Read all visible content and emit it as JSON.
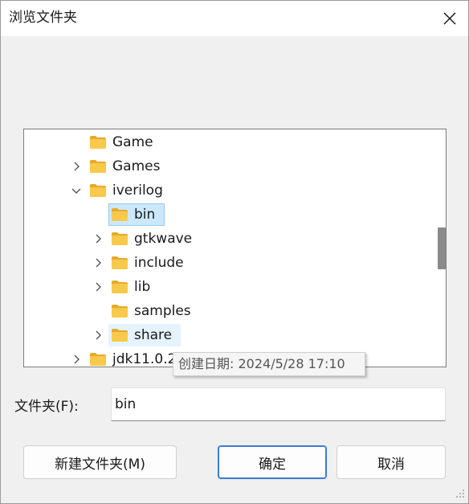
{
  "window": {
    "title": "浏览文件夹"
  },
  "tree": {
    "items": [
      {
        "label": "Game",
        "expander": "none"
      },
      {
        "label": "Games",
        "expander": "collapsed"
      },
      {
        "label": "iverilog",
        "expander": "expanded"
      },
      {
        "label": "bin",
        "expander": "none",
        "state": "selected"
      },
      {
        "label": "gtkwave",
        "expander": "collapsed"
      },
      {
        "label": "include",
        "expander": "collapsed"
      },
      {
        "label": "lib",
        "expander": "collapsed"
      },
      {
        "label": "samples",
        "expander": "none"
      },
      {
        "label": "share",
        "expander": "collapsed",
        "state": "hover"
      },
      {
        "label": "jdk11.0.2",
        "expander": "collapsed"
      }
    ]
  },
  "tooltip": {
    "text": "创建日期: 2024/5/28 17:10"
  },
  "folder_field": {
    "label": "文件夹(F):",
    "value": "bin"
  },
  "buttons": {
    "new_folder": "新建文件夹(M)",
    "ok": "确定",
    "cancel": "取消"
  },
  "colors": {
    "folder_yellow": "#f8c94a",
    "folder_dark": "#e8a92a",
    "selection": "#cce8ff",
    "accent": "#3a7bd5"
  }
}
